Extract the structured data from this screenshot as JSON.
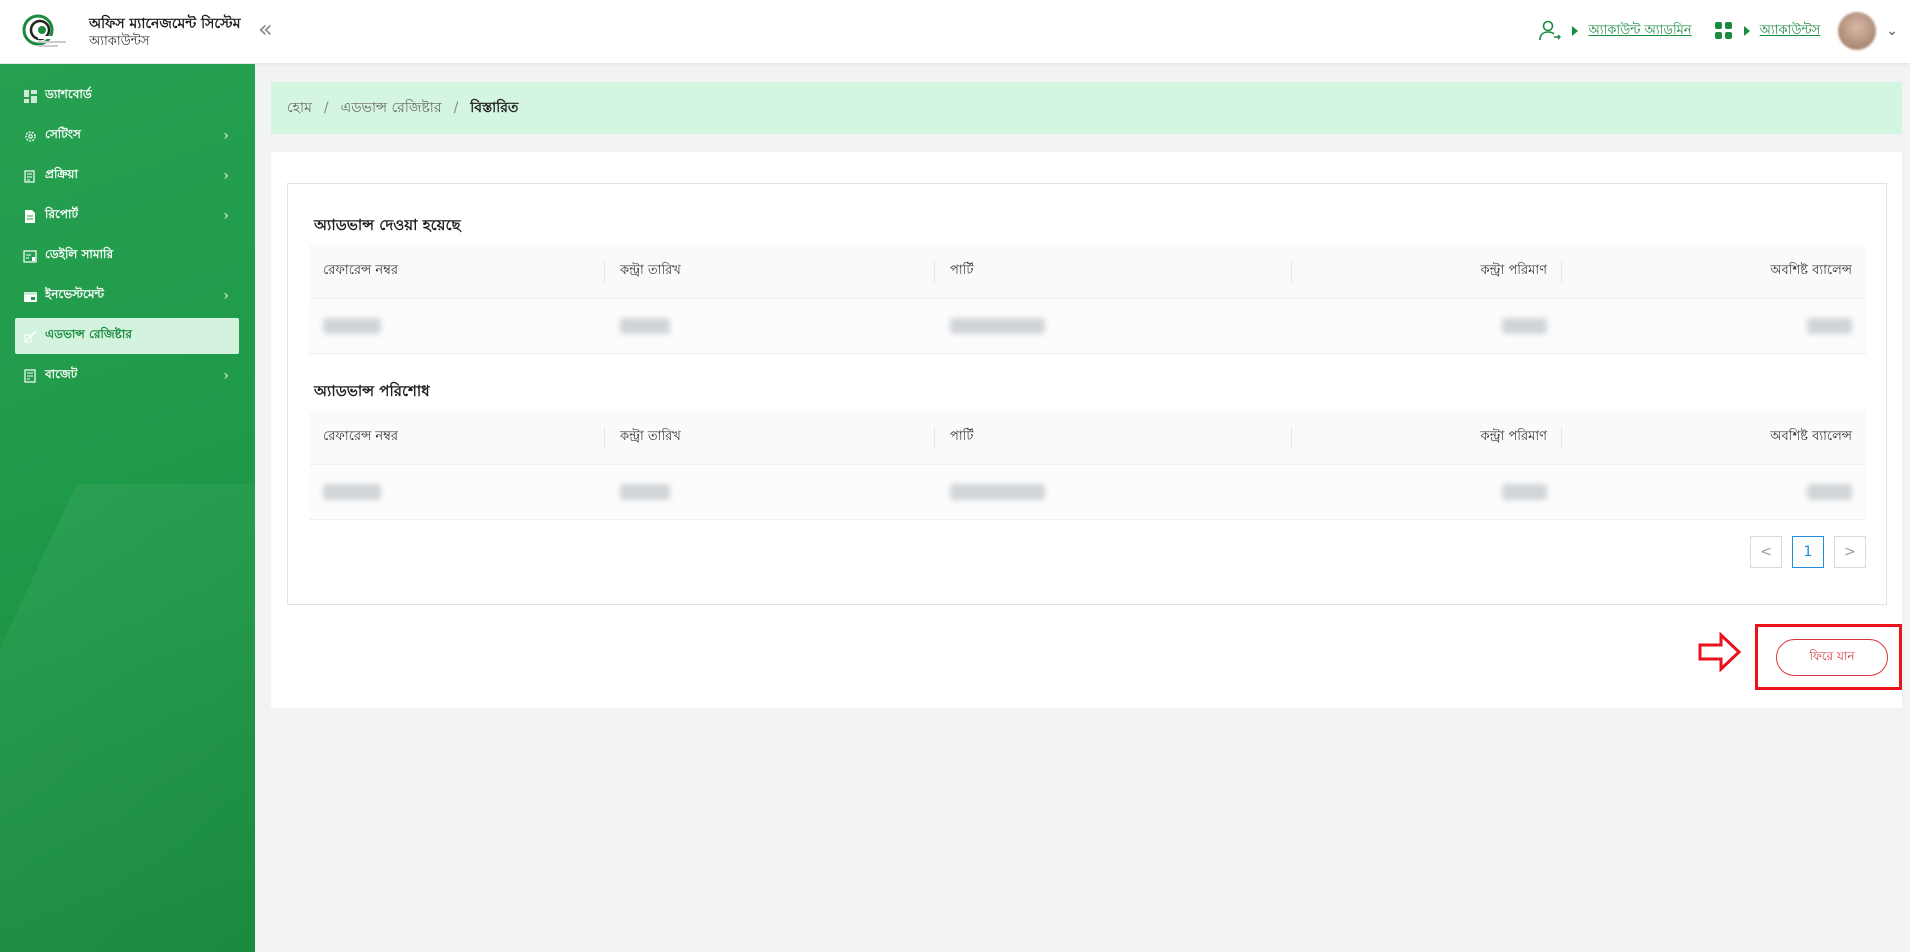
{
  "header": {
    "app_title": "অফিস ম্যানেজমেন্ট সিস্টেম",
    "app_subtitle": "অ্যাকাউন্টস",
    "user_role_link": "অ্যাকাউন্ট অ্যাডমিন",
    "module_link": "অ্যাকাউন্টস"
  },
  "sidebar": {
    "items": [
      {
        "label": "ড্যাশবোর্ড",
        "icon": "dashboard-icon"
      },
      {
        "label": "সেটিংস",
        "icon": "gear-icon"
      },
      {
        "label": "প্রক্রিয়া",
        "icon": "process-icon"
      },
      {
        "label": "রিপোর্ট",
        "icon": "document-icon"
      },
      {
        "label": "ডেইলি সামারি",
        "icon": "summary-icon"
      },
      {
        "label": "ইনভেস্টমেন্ট",
        "icon": "investment-icon"
      },
      {
        "label": "এডভান্স রেজিষ্টার",
        "icon": "register-icon"
      },
      {
        "label": "বাজেট",
        "icon": "budget-icon"
      }
    ],
    "active_index": 6
  },
  "breadcrumb": {
    "home": "হোম",
    "parent": "এডভান্স রেজিষ্টার",
    "current": "বিস্তারিত"
  },
  "sections": [
    {
      "title": "অ্যাডভান্স দেওয়া হয়েছে",
      "columns": [
        "রেফারেন্স নম্বর",
        "কন্ট্রা তারিখ",
        "পার্টি",
        "কন্ট্রা পরিমাণ",
        "অবশিষ্ট ব্যালেন্স"
      ]
    },
    {
      "title": "অ্যাডভান্স পরিশোধ",
      "columns": [
        "রেফারেন্স নম্বর",
        "কন্ট্রা তারিখ",
        "পার্টি",
        "কন্ট্রা পরিমাণ",
        "অবশিষ্ট ব্যালেন্স"
      ]
    }
  ],
  "pagination": {
    "current": "1",
    "prev": "<",
    "next": ">"
  },
  "back_button": "ফিরে যান",
  "colors": {
    "brand": "#1a8a3e",
    "accent_light": "#d4f5e0",
    "danger": "#d9363e",
    "highlight": "#e8131b"
  }
}
